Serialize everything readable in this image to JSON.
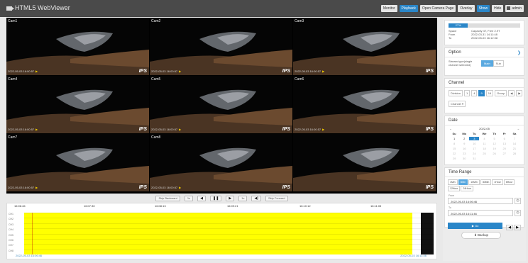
{
  "app": {
    "title": "HTML5 WebViewer"
  },
  "topbar": {
    "buttons": [
      {
        "label": "Monitor",
        "on": false
      },
      {
        "label": "Playback",
        "on": true
      },
      {
        "label": "Open Camera Page",
        "on": false
      },
      {
        "label": "Overlay",
        "on": false
      },
      {
        "label": "Show",
        "on": true
      },
      {
        "label": "Hide",
        "on": false
      }
    ],
    "user": "admin"
  },
  "cameras": [
    {
      "name": "Cam1",
      "timestamp": "2022-05-03 16:00:57",
      "brand": "IPS"
    },
    {
      "name": "Cam2",
      "timestamp": "2022-05-03 16:00:57",
      "brand": "IPS"
    },
    {
      "name": "Cam3",
      "timestamp": "2022-05-03 16:00:57",
      "brand": "IPS"
    },
    {
      "name": "Cam4",
      "timestamp": "2022-05-03 16:00:57",
      "brand": "IPS"
    },
    {
      "name": "Cam5",
      "timestamp": "2022-05-03 16:00:57",
      "brand": "IPS"
    },
    {
      "name": "Cam6",
      "timestamp": "2022-05-03 16:00:57",
      "brand": "IPS"
    },
    {
      "name": "Cam7",
      "timestamp": "2022-05-03 16:00:57",
      "brand": "IPS"
    },
    {
      "name": "Cam8",
      "timestamp": "2022-05-03 16:00:57",
      "brand": "IPS"
    },
    {
      "name": "",
      "timestamp": "",
      "brand": "IPS"
    }
  ],
  "playback": {
    "skip_back": "Skip Backward",
    "speed_left": "1x",
    "speed_right": "1x",
    "skip_fwd": "Skip Forward"
  },
  "timeline": {
    "ticks": [
      "16:06:46",
      "16:07:30",
      "16:08:13",
      "16:09:21",
      "16:10:12",
      "16:11:03"
    ],
    "channels": [
      "CH1",
      "CH2",
      "CH3",
      "CH4",
      "CH5",
      "CH6",
      "CH7",
      "CH8"
    ],
    "start": "2022-05-03 16:06:46",
    "end": "2022-05-03 16:11:46"
  },
  "storage": {
    "percent_label": "27%",
    "percent": 27,
    "space_label": "Space",
    "space_value": "Capacity 4T, Free 2.9T",
    "from_label": "From",
    "from_value": "2022-03-31 14:11:48",
    "to_label": "To",
    "to_value": "2022-05-03 16:12:08"
  },
  "option": {
    "title": "Option",
    "stream_label": "Stream type(single channel selected)",
    "seg": [
      "Main",
      "Sub"
    ]
  },
  "channel": {
    "title": "Channel",
    "division_label": "Division",
    "divisions": [
      "1",
      "4",
      "9",
      "16"
    ],
    "group_label": "Group",
    "channel_label": "Channel"
  },
  "date": {
    "title": "Date",
    "month": "2022-05",
    "days": [
      "Su",
      "Mo",
      "Tu",
      "We",
      "Th",
      "Fr",
      "Sa"
    ],
    "cells": [
      "1",
      "2",
      "3",
      "4",
      "5",
      "6",
      "7",
      "8",
      "9",
      "10",
      "11",
      "12",
      "13",
      "14",
      "15",
      "16",
      "17",
      "18",
      "19",
      "20",
      "21",
      "22",
      "23",
      "24",
      "25",
      "26",
      "27",
      "28",
      "29",
      "30",
      "31",
      "",
      "",
      "",
      ""
    ],
    "selected": "3"
  },
  "time_range": {
    "title": "Time Range",
    "options": [
      "1Min",
      "5Min",
      "10Min",
      "30Min",
      "1Hour",
      "6Hour",
      "12Hour",
      "24Hour"
    ],
    "selected": "5Min",
    "from_label": "From",
    "from_value": "2022-05-03 16:06:46",
    "to_label": "To",
    "to_value": "2022-05-03 16:11:46",
    "go_label": "Go"
  },
  "backup": {
    "label": "Backup"
  }
}
